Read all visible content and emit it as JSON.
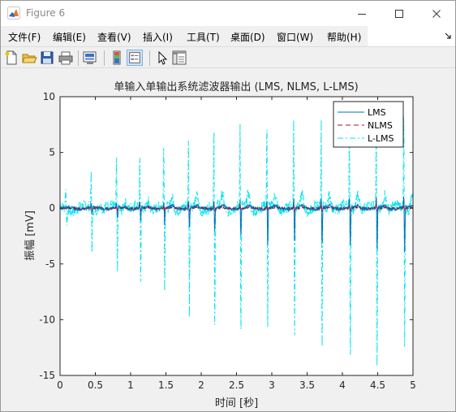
{
  "window": {
    "title": "Figure 6"
  },
  "menu": {
    "items": [
      "文件(F)",
      "编辑(E)",
      "查看(V)",
      "插入(I)",
      "工具(T)",
      "桌面(D)",
      "窗口(W)",
      "帮助(H)"
    ]
  },
  "colors": {
    "lms": "#0072BD",
    "nlms": "#A2142F",
    "llms": "#00E5EE",
    "axes_bg": "#ffffff",
    "figure_bg": "#f0f0f0"
  },
  "chart_data": {
    "type": "line",
    "title": "单输入单输出系统滤波器输出 (LMS, NLMS, L-LMS)",
    "xlabel": "时间 [秒]",
    "ylabel": "振幅 [mV]",
    "xlim": [
      0,
      5
    ],
    "ylim": [
      -15,
      10
    ],
    "xticks": [
      0,
      0.5,
      1,
      1.5,
      2,
      2.5,
      3,
      3.5,
      4,
      4.5,
      5
    ],
    "xtick_labels": [
      "0",
      "0.5",
      "1",
      "1.5",
      "2",
      "2.5",
      "3",
      "3.5",
      "4",
      "4.5",
      "5"
    ],
    "yticks": [
      -15,
      -10,
      -5,
      0,
      5,
      10
    ],
    "ytick_labels": [
      "-15",
      "-10",
      "-5",
      "0",
      "5",
      "10"
    ],
    "legend_position": "top-right",
    "series": [
      {
        "name": "LMS",
        "line_style": "solid",
        "beat_times": [
          0.44,
          0.8,
          1.13,
          1.47,
          1.82,
          2.18,
          2.55,
          2.93,
          3.31,
          3.7,
          4.1,
          4.48,
          4.87
        ],
        "peak_values": [
          0.4,
          0.5,
          0.6,
          0.7,
          0.8,
          0.8,
          0.9,
          0.9,
          0.9,
          1.0,
          1.0,
          1.1,
          1.1
        ],
        "trough_values": [
          -0.8,
          -1.0,
          -1.2,
          -1.5,
          -1.8,
          -2.2,
          -2.5,
          -3.2,
          -3.0,
          -3.5,
          -3.6,
          -3.8,
          -4.0
        ],
        "baseline": 0.1
      },
      {
        "name": "NLMS",
        "line_style": "dashed",
        "beat_times": [
          0.44,
          0.8,
          1.13,
          1.47,
          1.82,
          2.18,
          2.55,
          2.93,
          3.31,
          3.7,
          4.1,
          4.48,
          4.87
        ],
        "peak_values": [
          0.2,
          0.2,
          0.3,
          0.3,
          0.3,
          0.3,
          0.4,
          0.4,
          0.4,
          0.4,
          0.4,
          0.4,
          0.4
        ],
        "trough_values": [
          -0.2,
          -0.2,
          -0.3,
          -0.3,
          -0.3,
          -0.3,
          -0.3,
          -0.3,
          -0.3,
          -0.3,
          -0.3,
          -0.3,
          -0.3
        ],
        "baseline": 0.0
      },
      {
        "name": "L-LMS",
        "line_style": "dashdot",
        "beat_times": [
          0.44,
          0.8,
          1.13,
          1.47,
          1.82,
          2.18,
          2.55,
          2.93,
          3.31,
          3.7,
          4.1,
          4.48,
          4.87
        ],
        "peak_values": [
          3.2,
          4.6,
          5.0,
          6.1,
          6.8,
          7.4,
          7.5,
          7.6,
          8.2,
          8.2,
          8.5,
          8.5,
          8.7
        ],
        "trough_values": [
          -4.2,
          -6.5,
          -7.3,
          -7.8,
          -9.8,
          -11.8,
          -12.2,
          -11.3,
          -12.0,
          -14.0,
          -14.4,
          -14.7,
          -13.0
        ],
        "baseline": 0.3,
        "start_spike": {
          "x": 0.08,
          "peak": 1.8,
          "trough": -1.4
        }
      }
    ]
  }
}
